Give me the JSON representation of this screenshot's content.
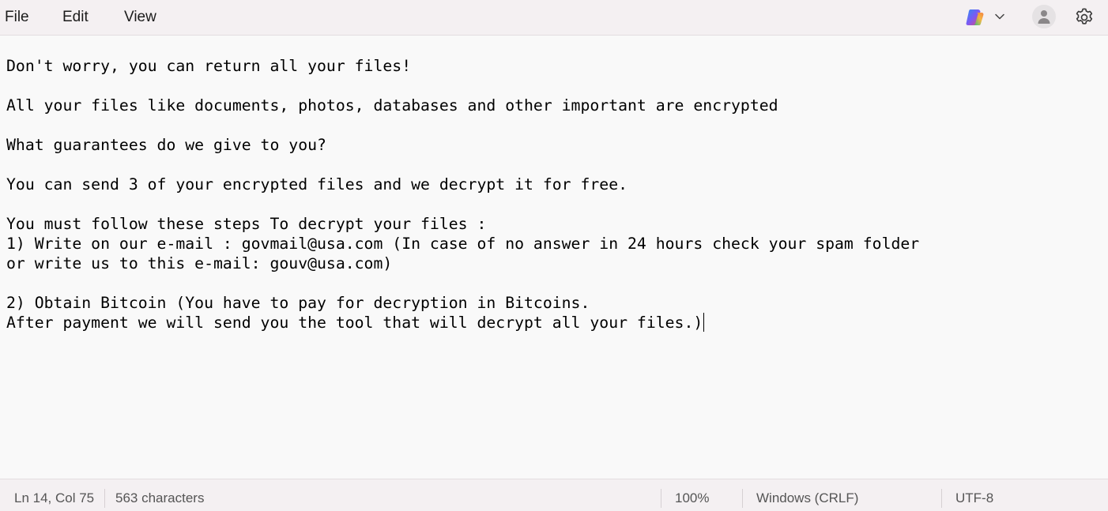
{
  "menu": {
    "file": "File",
    "edit": "Edit",
    "view": "View"
  },
  "toolbar": {
    "copilot_icon": "copilot-icon",
    "dropdown_icon": "chevron-down-icon",
    "account_icon": "user-icon",
    "settings_icon": "gear-icon"
  },
  "document": {
    "lines": [
      "Don't worry, you can return all your files!",
      "",
      "All your files like documents, photos, databases and other important are encrypted",
      "",
      "What guarantees do we give to you?",
      "",
      "You can send 3 of your encrypted files and we decrypt it for free.",
      "",
      "You must follow these steps To decrypt your files :",
      "1) Write on our e-mail : govmail@usa.com (In case of no answer in 24 hours check your spam folder",
      "or write us to this e-mail: gouv@usa.com)",
      "",
      "2) Obtain Bitcoin (You have to pay for decryption in Bitcoins.",
      "After payment we will send you the tool that will decrypt all your files.)"
    ]
  },
  "status": {
    "position": "Ln 14, Col 75",
    "characters": "563 characters",
    "zoom": "100%",
    "line_ending": "Windows (CRLF)",
    "encoding": "UTF-8"
  },
  "colors": {
    "bar_background": "#f4f0f2",
    "editor_background": "#f9f9f9",
    "text": "#000000"
  }
}
